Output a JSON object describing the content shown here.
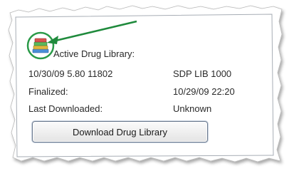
{
  "library": {
    "active_label": "Active Drug Library:",
    "version_value": "10/30/09 5.80 11802",
    "library_name": "SDP LIB 1000",
    "finalized_label": "Finalized:",
    "finalized_value": "10/29/09 22:20",
    "last_downloaded_label": "Last Downloaded:",
    "last_downloaded_value": "Unknown"
  },
  "actions": {
    "download_label": "Download Drug Library"
  },
  "icons": {
    "app_icon": "books-stack-icon",
    "annotation_arrow": "arrow-icon"
  },
  "colors": {
    "annotation": "#1f8a3c",
    "icon_ring": "#2a9a48",
    "panel_border": "#9aa3ad"
  }
}
